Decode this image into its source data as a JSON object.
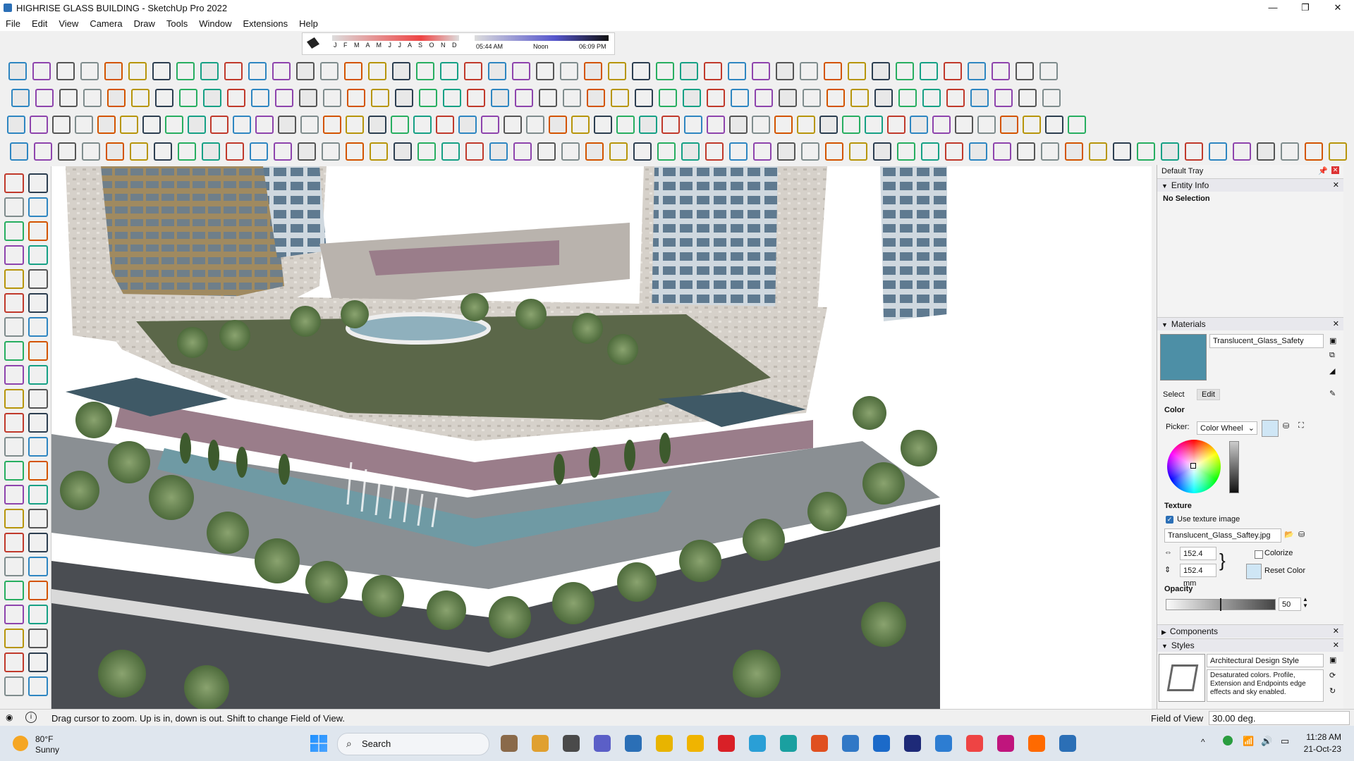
{
  "window": {
    "title": "HIGHRISE GLASS BUILDING - SketchUp Pro 2022",
    "minimize": "—",
    "maximize": "❐",
    "close": "✕"
  },
  "menu": [
    "File",
    "Edit",
    "View",
    "Camera",
    "Draw",
    "Tools",
    "Window",
    "Extensions",
    "Help"
  ],
  "shadow_bar": {
    "months": "J F M A M J J A S O N D",
    "time_start": "05:44 AM",
    "time_mid": "Noon",
    "time_end": "06:09 PM"
  },
  "tray": {
    "title": "Default Tray",
    "entity_info": {
      "header": "Entity Info",
      "selection": "No Selection"
    },
    "materials": {
      "header": "Materials",
      "name": "Translucent_Glass_Safety",
      "tabs": [
        "Select",
        "Edit"
      ],
      "color_label": "Color",
      "picker_label": "Picker:",
      "picker_value": "Color Wheel",
      "swatch_color": "#cfe6f5",
      "texture_label": "Texture",
      "use_texture": "Use texture image",
      "texture_file": "Translucent_Glass_Saftey.jpg",
      "width": "152.4 mm",
      "height": "152.4 mm",
      "colorize": "Colorize",
      "reset_color": "Reset Color",
      "opacity_label": "Opacity",
      "opacity_value": "50"
    },
    "components": {
      "header": "Components"
    },
    "styles": {
      "header": "Styles",
      "name": "Architectural Design Style",
      "description": "Desaturated colors. Profile, Extension and Endpoints edge effects and sky enabled."
    }
  },
  "status": {
    "message": "Drag cursor to zoom.  Up is in, down is out. Shift to change Field of View.",
    "measure_label": "Field of View",
    "measure_value": "30.00 deg."
  },
  "taskbar": {
    "weather_temp": "80°F",
    "weather_cond": "Sunny",
    "search": "Search",
    "time": "11:28 AM",
    "date": "21-Oct-23"
  },
  "colors": {
    "accent": "#2b6fb6",
    "sky": "#ffffff",
    "lawn": "#5a6648",
    "stone": "#cfcac3"
  }
}
